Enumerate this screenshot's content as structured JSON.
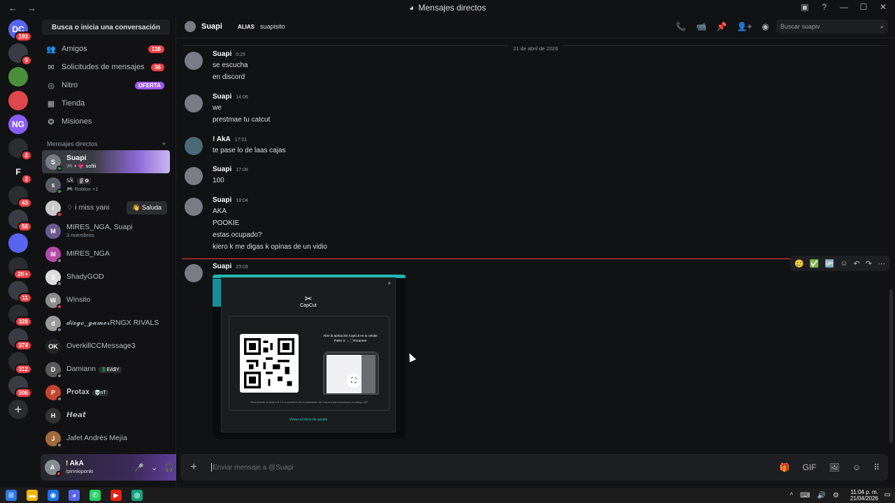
{
  "window": {
    "title": "Mensajes directos",
    "back": "←",
    "forward": "→"
  },
  "titlebar_controls": {
    "inbox": "▣",
    "help": "?",
    "minimize": "—",
    "maximize": "☐",
    "close": "✕"
  },
  "servers": [
    {
      "label": "DC",
      "badge": "193",
      "color": "#5865f2"
    },
    {
      "label": "",
      "badge": "9",
      "color": "#3a3c43"
    },
    {
      "label": "",
      "badge": "",
      "color": "#4a8f3a"
    },
    {
      "label": "",
      "badge": "",
      "color": "#e0474c"
    },
    {
      "label": "NG",
      "badge": "",
      "color": "#8a5cf6"
    },
    {
      "label": "",
      "badge": "2",
      "color": "#2b2d31"
    },
    {
      "label": "F",
      "badge": "2",
      "color": "#111214"
    },
    {
      "label": "",
      "badge": "43",
      "color": "#2b2d31"
    },
    {
      "label": "",
      "badge": "58",
      "color": "#3a3c43"
    },
    {
      "label": "",
      "badge": "",
      "color": "#5865f2"
    },
    {
      "label": "",
      "badge": "2K+",
      "color": "#2b2d31"
    },
    {
      "label": "",
      "badge": "11",
      "color": "#3a3c43"
    },
    {
      "label": "",
      "badge": "328",
      "color": "#2b2d31"
    },
    {
      "label": "",
      "badge": "374",
      "color": "#3a3c43"
    },
    {
      "label": "",
      "badge": "312",
      "color": "#2b2d31"
    },
    {
      "label": "",
      "badge": "506",
      "color": "#3a3c43"
    }
  ],
  "add_server": "+",
  "search_button": "Busca o inicia una conversación",
  "nav": [
    {
      "icon": "👥",
      "label": "Amigos",
      "pill": "138"
    },
    {
      "icon": "✉",
      "label": "Solicitudes de mensajes",
      "pill": "56"
    },
    {
      "icon": "◎",
      "label": "Nitro",
      "pill": "OFERTA"
    },
    {
      "icon": "▦",
      "label": "Tienda",
      "pill": ""
    },
    {
      "icon": "❂",
      "label": "Misiones",
      "pill": ""
    }
  ],
  "dm_header": {
    "label": "Mensajes directos",
    "add": "+"
  },
  "dms": [
    {
      "name": "Suapi",
      "sub": "🎮 • 💗 sofiii",
      "initial": "S",
      "status": "on"
    },
    {
      "name": "sk",
      "sub": "🎮 Roblox +1",
      "tag": "🗿✿",
      "initial": "s",
      "status": "on"
    },
    {
      "name": "♢ i miss yani",
      "sub": "",
      "initial": "i",
      "status": "dnd",
      "action": "👋 Saluda"
    },
    {
      "name": "MIRES_NGA, Suapi",
      "sub": "3 miembros",
      "initial": "M",
      "status": "none"
    },
    {
      "name": "MIRES_NGA",
      "sub": "",
      "initial": "M",
      "status": "off"
    },
    {
      "name": "ShadyGOD",
      "sub": "",
      "initial": "S",
      "status": "off"
    },
    {
      "name": "Winsito",
      "sub": "",
      "initial": "W",
      "status": "dnd"
    },
    {
      "name": "𝓭𝓲𝓮𝓰𝓸_𝓰𝓪𝓶𝓮𝓻RNGX RIVALS",
      "sub": "",
      "initial": "d",
      "status": "off"
    },
    {
      "name": "OverkillCCMessage3",
      "sub": "",
      "initial": "OK",
      "status": "none"
    },
    {
      "name": "Damiann",
      "sub": "",
      "tag": "💲EA$Y",
      "initial": "D",
      "status": "off"
    },
    {
      "name": "𝐏𝐫𝐨𝐭𝐚𝐱",
      "sub": "",
      "tag": "💀nT",
      "initial": "P",
      "status": "off"
    },
    {
      "name": "𝙃𝙚𝙖𝙩",
      "sub": "",
      "initial": "H",
      "status": "none"
    },
    {
      "name": "Jafet Andrés Mejía",
      "sub": "",
      "initial": "J",
      "status": "off"
    }
  ],
  "user_panel": {
    "name": "! AkA",
    "sub": "/pirinkiponki",
    "initial": "A",
    "mic": "🎤",
    "headset": "🎧",
    "chev": "⌄",
    "settings": "⚙"
  },
  "chat_header": {
    "name": "Suapi",
    "alias_label": "ALIAS",
    "alias_value": "suapisito",
    "search_placeholder": "Buscar suapiv",
    "icons": [
      "📞",
      "📹",
      "📌",
      "👤+",
      "◉"
    ],
    "search_icon": "⌕"
  },
  "date_divider": "21 de abril de 2026",
  "messages": [
    {
      "author": "Suapi",
      "time": "0:25",
      "lines": [
        "se escucha",
        "en discord"
      ]
    },
    {
      "author": "Suapi",
      "time": "14:06",
      "lines": [
        "we",
        "prestmae tu catcut"
      ]
    },
    {
      "author": "! AkA",
      "time": "17:01",
      "lines": [
        "te pase lo de laas cajas"
      ]
    },
    {
      "author": "Suapi",
      "time": "17:08",
      "lines": [
        "100"
      ]
    },
    {
      "author": "Suapi",
      "time": "19:04",
      "lines": [
        "AKA",
        "POOKIE",
        "estas ocupado?",
        "kiero k me digas k opinas de un vidio"
      ]
    },
    {
      "author": "Suapi",
      "time": "23:03",
      "lines": []
    }
  ],
  "hover_actions": [
    "🥲",
    "✅",
    "🆙",
    "☺",
    "↶",
    "↷",
    "⋯"
  ],
  "capcut_embed": {
    "close": "×",
    "logo_mark": "✂",
    "logo_text": "CapCut",
    "instruction_1": "Abre la aplicación CapCut en tu celular",
    "instruction_2": "Pulsa ⊙ → ⛶ Escanear",
    "scan_glyph": "⛶",
    "footer": "Recuérdate la sesión 8.7.0 o posterior de la aplicación de CapCut para escanear el código QR",
    "back_link": "Volver al inicio de sesión"
  },
  "composer": {
    "plus": "+",
    "placeholder": "Enviar mensaje a @Suapi",
    "icons": [
      "🎁",
      "GIF",
      "🖼",
      "☺",
      "⠿"
    ]
  },
  "taskbar": {
    "icons": [
      {
        "glyph": "⊞",
        "color": "#2b78e4"
      },
      {
        "glyph": "▬",
        "color": "#f2b705"
      },
      {
        "glyph": "◉",
        "color": "#1a73e8"
      },
      {
        "glyph": "◕",
        "color": "#5865f2"
      },
      {
        "glyph": "✆",
        "color": "#25d366"
      },
      {
        "glyph": "▶",
        "color": "#e62117"
      },
      {
        "glyph": "◍",
        "color": "#10a37f"
      }
    ],
    "tray": [
      "^",
      "⌨",
      "🔊",
      "⚙"
    ],
    "time": "11:04 p. m.",
    "date": "21/04/2026",
    "notif": "▭"
  }
}
